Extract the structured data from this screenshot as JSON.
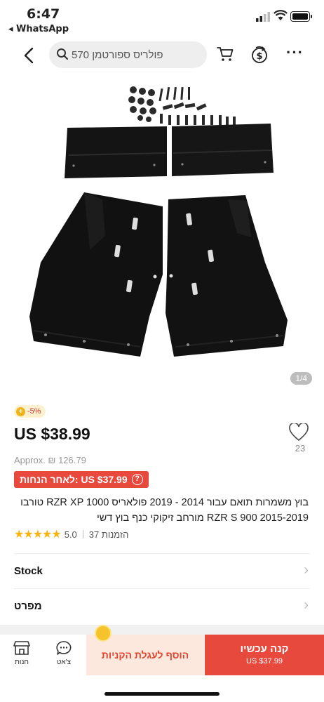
{
  "status_bar": {
    "time": "6:47",
    "back_app": "◂ WhatsApp"
  },
  "search": {
    "query": "פולריס ספורטמן 570"
  },
  "icons": {
    "back": "chevron-left-icon",
    "search": "search-icon",
    "cart": "cart-icon",
    "coin": "coin-dollar-icon",
    "more": "more-icon",
    "heart": "heart-icon",
    "store": "store-icon",
    "chat": "chat-icon"
  },
  "gallery": {
    "counter": "1/4"
  },
  "product": {
    "discount_badge": "-5%",
    "price": "US $38.99",
    "approx": "Approx. ₪ 126.79",
    "coupon_text": "US $37.99 :לאחר הנחות",
    "wishlist_count": "23",
    "title": "בוץ משמרות תואם עבור 2014 - 2019 פולאריס RZR XP 1000 טורבו RZR S 900 2015-2019 מורחב זיקוקי כנף בוץ דשי",
    "rating": "5.0",
    "orders": "37 הזמנות",
    "stars": "★★★★★"
  },
  "rows": [
    {
      "label": "Stock"
    },
    {
      "label": "מפרט"
    }
  ],
  "bottom": {
    "store_label": "חנות",
    "chat_label": "צ'אט",
    "add_to_cart": "הוסף לעגלת הקניות",
    "buy_now": "קנה עכשיו",
    "buy_price": "US $37.99"
  },
  "colors": {
    "accent": "#e7493c",
    "star": "#f7b20b",
    "add_cart_bg": "#fde8de"
  }
}
